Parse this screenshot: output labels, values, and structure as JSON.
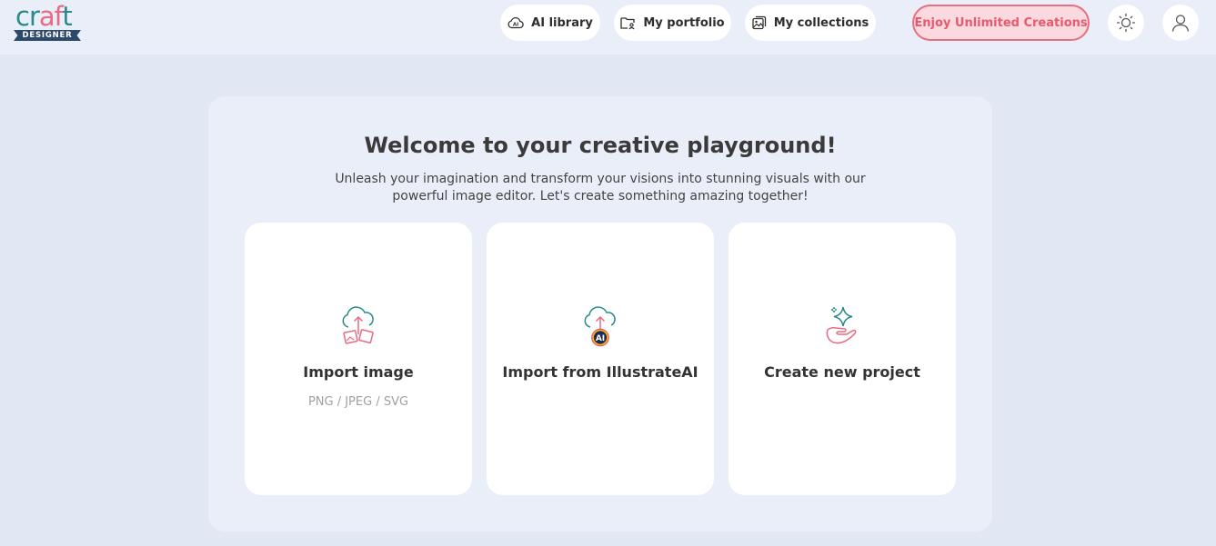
{
  "logo": {
    "top": "craft",
    "craft_c": "cr",
    "craft_a": "a",
    "craft_f": "f",
    "craft_t": "t",
    "banner": "DESIGNER"
  },
  "nav": {
    "ai_library": "AI library",
    "ai_badge": "AI",
    "portfolio": "My portfolio",
    "collections": "My collections",
    "enjoy": "Enjoy Unlimited Creations"
  },
  "main": {
    "title": "Welcome to your creative playground!",
    "subtitle": "Unleash your imagination and transform your visions into stunning visuals with our powerful image editor. Let's create something amazing together!",
    "cards": [
      {
        "title": "Import image",
        "sub": "PNG / JPEG / SVG",
        "icon": "cloud-upload-images-icon"
      },
      {
        "title": "Import from IllustrateAI",
        "sub": "",
        "icon": "cloud-upload-ai-icon",
        "badge": "AI"
      },
      {
        "title": "Create new project",
        "sub": "",
        "icon": "hand-sparkle-icon"
      }
    ]
  },
  "colors": {
    "teal": "#2a8a8a",
    "pink": "#e86a84",
    "navy": "#2e4a6b",
    "background": "#e1e8f4",
    "panel": "#e9eef8"
  }
}
